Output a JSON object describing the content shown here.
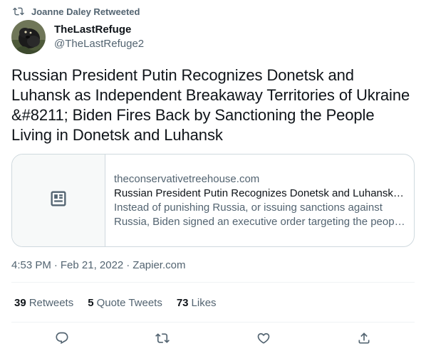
{
  "retweet_context": {
    "text": "Joanne Daley Retweeted",
    "icon": "retweet-icon"
  },
  "author": {
    "display_name": "TheLastRefuge",
    "handle": "@TheLastRefuge2",
    "avatar": "avatar-image"
  },
  "tweet": {
    "text": "Russian President Putin Recognizes Donetsk and Luhansk as Independent Breakaway Territories of Ukraine &#8211; Biden Fires Back by Sanctioning the People Living in Donetsk and Luhansk"
  },
  "link_card": {
    "icon": "article-icon",
    "domain": "theconservativetreehouse.com",
    "title": "Russian President Putin Recognizes Donetsk and Luhansk as Independent Breakaway Territories of Ukraine",
    "description": "Instead of punishing Russia, or issuing sanctions against Russia, Biden signed an executive order targeting the people living in Donetsk and Luhansk"
  },
  "meta": {
    "time": "4:53 PM",
    "separator": "·",
    "date": "Feb 21, 2022",
    "source": "Zapier.com"
  },
  "stats": {
    "retweets_count": "39",
    "retweets_label": "Retweets",
    "quotes_count": "5",
    "quotes_label": "Quote Tweets",
    "likes_count": "73",
    "likes_label": "Likes"
  },
  "actions": [
    {
      "name": "reply",
      "icon": "reply-icon"
    },
    {
      "name": "retweet",
      "icon": "retweet-icon"
    },
    {
      "name": "like",
      "icon": "heart-icon"
    },
    {
      "name": "share",
      "icon": "share-icon"
    }
  ],
  "colors": {
    "primary_text": "#0f1419",
    "secondary_text": "#536471",
    "border": "#cfd9de",
    "divider": "#eff3f4",
    "card_thumb_bg": "#f7f9f9"
  }
}
